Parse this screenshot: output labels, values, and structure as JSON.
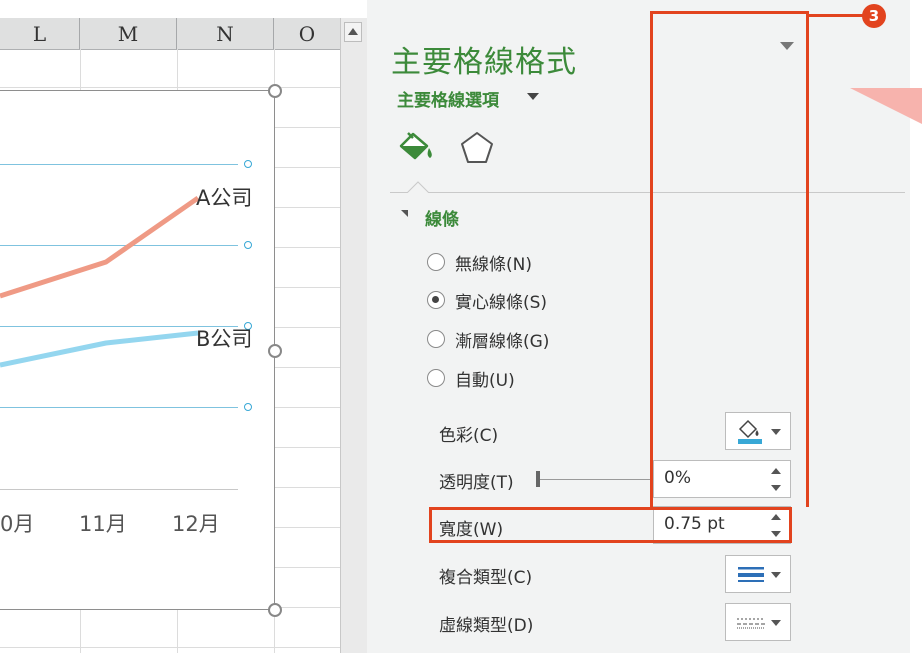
{
  "sheet": {
    "columns": [
      "L",
      "M",
      "N",
      "O"
    ]
  },
  "chart": {
    "series": [
      {
        "name": "A公司",
        "color": "#ef9a85"
      },
      {
        "name": "B公司",
        "color": "#94d6ef"
      }
    ],
    "x_ticks": [
      "0月",
      "11月",
      "12月"
    ],
    "gridline_color": "#7fc3df"
  },
  "pane": {
    "title": "主要格線格式",
    "subtitle": "主要格線選項",
    "tabs": [
      {
        "icon": "paint-bucket-icon"
      },
      {
        "icon": "pentagon-icon"
      }
    ],
    "section": "線條",
    "radios": [
      {
        "label": "無線條(N)",
        "checked": false
      },
      {
        "label": "實心線條(S)",
        "checked": true
      },
      {
        "label": "漸層線條(G)",
        "checked": false
      },
      {
        "label": "自動(U)",
        "checked": false
      }
    ],
    "props": {
      "color_label": "色彩(C)",
      "transparency_label": "透明度(T)",
      "transparency_value": "0%",
      "width_label": "寬度(W)",
      "width_value": "0.75 pt",
      "compound_label": "複合類型(C)",
      "dash_label": "虛線類型(D)"
    },
    "accent": "#3c8a3a"
  },
  "callout": {
    "step": "3",
    "color": "#e2431e"
  }
}
